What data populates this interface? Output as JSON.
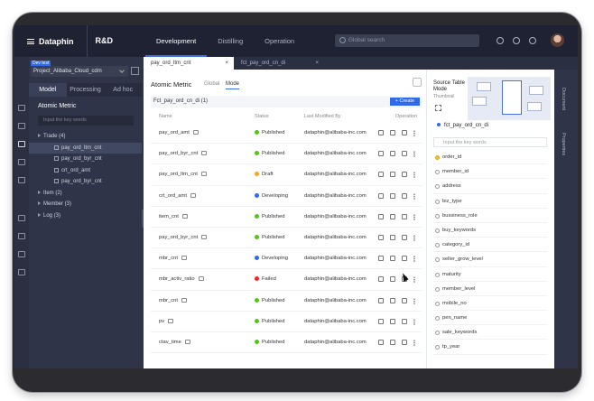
{
  "topbar": {
    "logo": "Dataphin",
    "project": "R&D",
    "nav": [
      "Development",
      "Distilling",
      "Operation"
    ],
    "active_nav": "Development",
    "search_placeholder": "Global search"
  },
  "left": {
    "env_badge": "Dev test",
    "project_select": "Project_Alibaba_Cloud_cdm",
    "tabs": [
      "Model",
      "Processing",
      "Ad hoc"
    ],
    "title": "Atomic Metric",
    "search_placeholder": "Input the key words",
    "tree": [
      {
        "label": "Trade (4)",
        "level": 0,
        "expanded": true
      },
      {
        "label": "pay_ord_ltm_cnt",
        "level": 1,
        "selected": true
      },
      {
        "label": "pay_ord_byr_cnt",
        "level": 1
      },
      {
        "label": "crt_ord_amt",
        "level": 1
      },
      {
        "label": "pay_ord_byr_cnt",
        "level": 1
      },
      {
        "label": "Item (2)",
        "level": 0
      },
      {
        "label": "Member (3)",
        "level": 0
      },
      {
        "label": "Log (3)",
        "level": 0
      }
    ]
  },
  "file_tabs": [
    "pay_ord_ltm_cnt",
    "fct_pay_ord_cn_di"
  ],
  "main": {
    "title": "Atomic Metric",
    "tabs": [
      "Global",
      "Mode"
    ],
    "sub_title": "Fct_pay_ord_cn_di (1)",
    "create_label": "+ Create",
    "columns": [
      "Name",
      "Status",
      "Last Modified By",
      "Operation"
    ],
    "rows": [
      {
        "name": "pay_ord_amt",
        "status": "Published",
        "modifier": "dataphin@alibaba-inc.com"
      },
      {
        "name": "pay_ord_byr_cnt",
        "status": "Published",
        "modifier": "dataphin@alibaba-inc.com"
      },
      {
        "name": "pay_ord_ltm_cnt",
        "status": "Draft",
        "modifier": "dataphin@alibaba-inc.com"
      },
      {
        "name": "crt_ord_amt",
        "status": "Developing",
        "modifier": "dataphin@alibaba-inc.com"
      },
      {
        "name": "item_cnt",
        "status": "Published",
        "modifier": "dataphin@alibaba-inc.com"
      },
      {
        "name": "pay_ord_byr_cnt",
        "status": "Published",
        "modifier": "dataphin@alibaba-inc.com"
      },
      {
        "name": "mbr_cnt",
        "status": "Developing",
        "modifier": "dataphin@alibaba-inc.com"
      },
      {
        "name": "mbr_activ_ratio",
        "status": "Failed",
        "modifier": "dataphin@alibaba-inc.com"
      },
      {
        "name": "mbr_cnt",
        "status": "Published",
        "modifier": "dataphin@alibaba-inc.com"
      },
      {
        "name": "pv",
        "status": "Published",
        "modifier": "dataphin@alibaba-inc.com"
      },
      {
        "name": "ctav_time",
        "status": "Published",
        "modifier": "dataphin@alibaba-inc.com"
      }
    ],
    "status_colors": {
      "Published": "#52c41a",
      "Draft": "#f5a623",
      "Developing": "#2f6ae8",
      "Failed": "#f5222d"
    }
  },
  "side": {
    "title": "Source Table Mode",
    "thumbnail_label": "Thumbnail",
    "selected_table": "fct_pay_ord_cn_di",
    "search_placeholder": "Input the key words",
    "fields": [
      "order_id",
      "member_id",
      "address",
      "biz_type",
      "bussiness_role",
      "buy_keywords",
      "category_id",
      "seller_grow_level",
      "maturity",
      "member_level",
      "mobile_no",
      "pen_name",
      "sale_keywords",
      "tp_year"
    ]
  },
  "right_tabs": [
    "Document",
    "Properties"
  ],
  "colors": {
    "accent": "#2f6ae8",
    "topbar": "#1e2232",
    "panel": "#2f3448"
  }
}
